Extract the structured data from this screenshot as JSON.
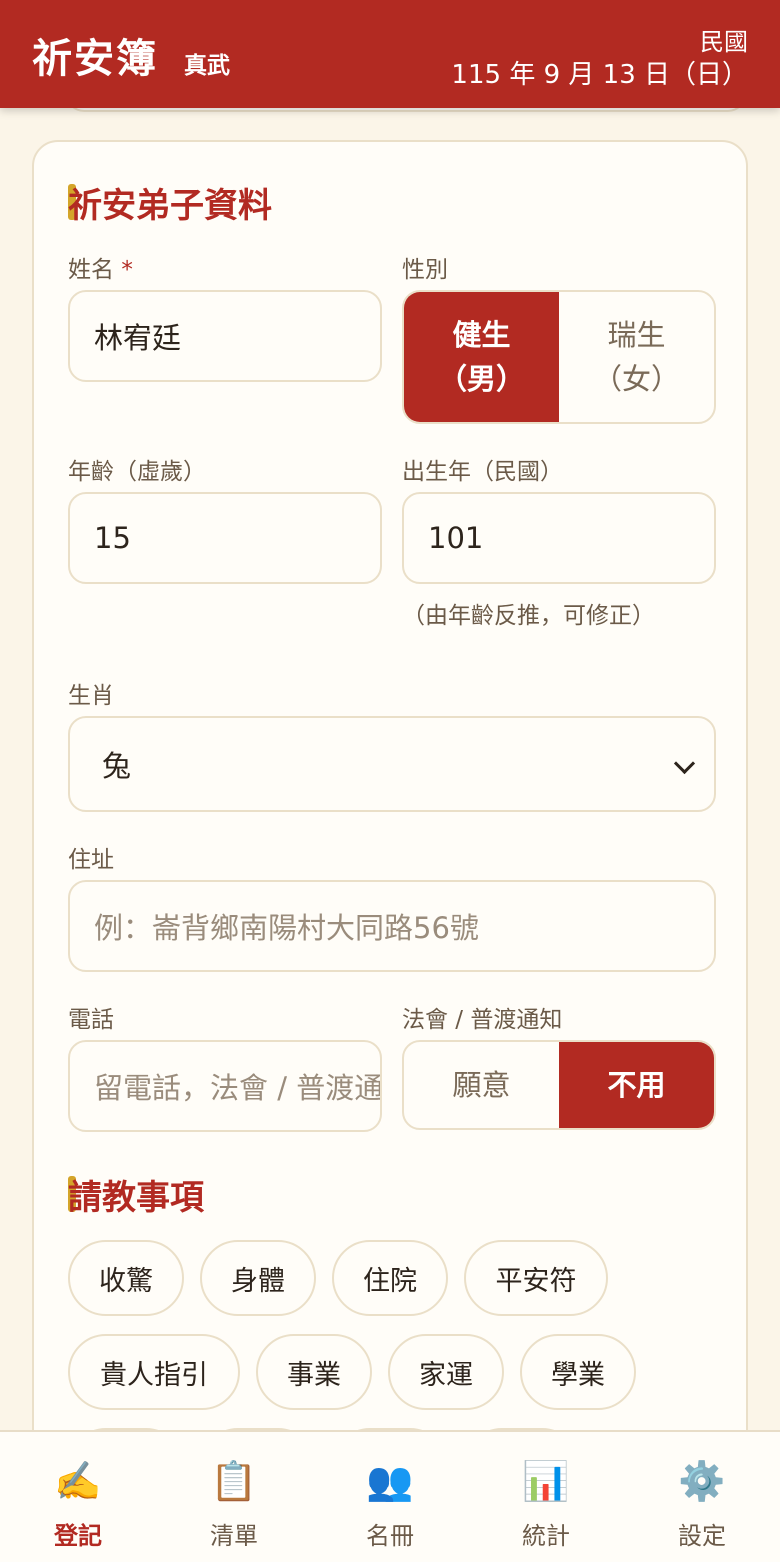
{
  "header": {
    "title": "祈安簿",
    "subtitle": "真武",
    "era": "民國",
    "date": "115 年 9 月 13 日（日）"
  },
  "section_profile": {
    "title": "祈安弟子資料",
    "name_label": "姓名",
    "name_required": "*",
    "name_value": "林宥廷",
    "gender_label": "性別",
    "gender_options": [
      {
        "line1": "健生",
        "line2": "（男）",
        "selected": true
      },
      {
        "line1": "瑞生",
        "line2": "（女）",
        "selected": false
      }
    ],
    "age_label": "年齡（虛歲）",
    "age_value": "15",
    "birth_year_label": "出生年（民國）",
    "birth_year_value": "101",
    "birth_year_hint": "（由年齡反推，可修正）",
    "zodiac_label": "生肖",
    "zodiac_value": "兔",
    "address_label": "住址",
    "address_placeholder": "例：崙背鄉南陽村大同路56號",
    "phone_label": "電話",
    "phone_placeholder": "留電話，法會 / 普渡通知",
    "notify_label": "法會 / 普渡通知",
    "notify_options": [
      {
        "label": "願意",
        "selected": false
      },
      {
        "label": "不用",
        "selected": true
      }
    ]
  },
  "section_topics": {
    "title": "請教事項",
    "chips": [
      "收驚",
      "身體",
      "住院",
      "平安符",
      "貴人指引",
      "事業",
      "家運",
      "學業"
    ]
  },
  "tabbar": {
    "items": [
      {
        "label": "登記",
        "icon": "✍️",
        "active": true
      },
      {
        "label": "清單",
        "icon": "📋",
        "active": false
      },
      {
        "label": "名冊",
        "icon": "👥",
        "active": false
      },
      {
        "label": "統計",
        "icon": "📊",
        "active": false
      },
      {
        "label": "設定",
        "icon": "⚙️",
        "active": false
      }
    ]
  },
  "colors": {
    "brand": "#b22a22",
    "accent": "#d4a52a",
    "background": "#fbf5e8"
  }
}
